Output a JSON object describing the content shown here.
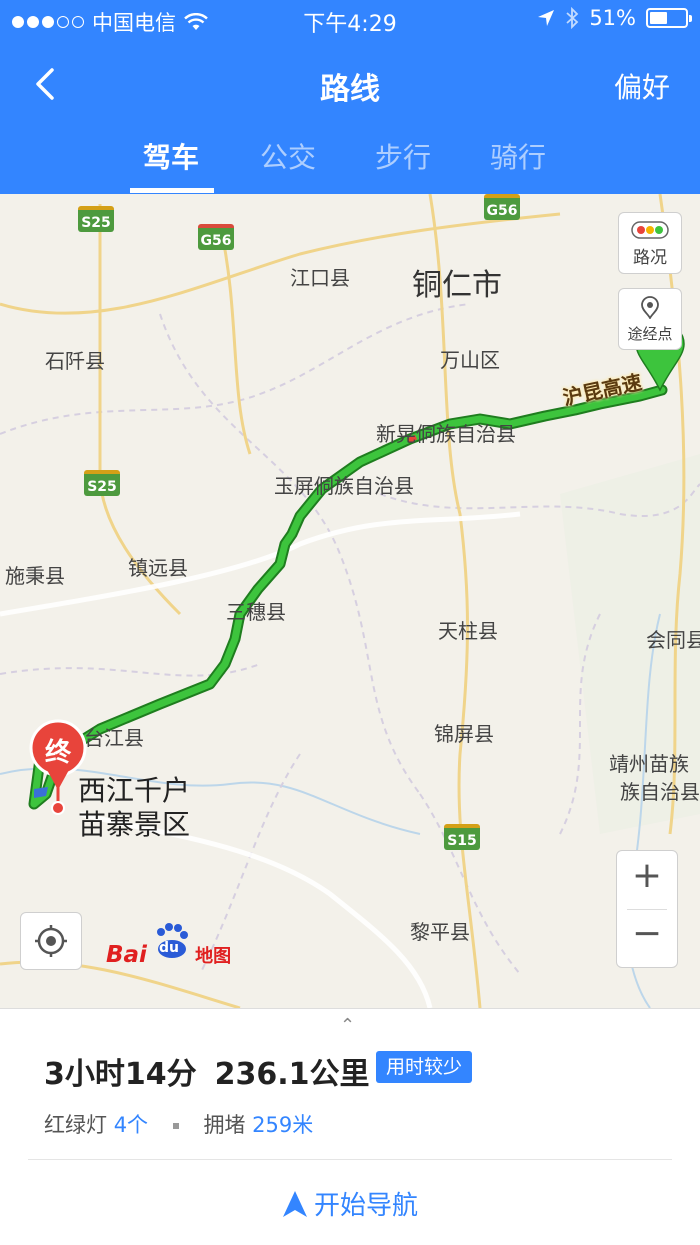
{
  "status_bar": {
    "carrier": "中国电信",
    "time": "下午4:29",
    "battery": "51%",
    "battery_level": 0.51
  },
  "nav": {
    "title": "路线",
    "right_action": "偏好"
  },
  "tabs": [
    {
      "label": "驾车",
      "active": true
    },
    {
      "label": "公交",
      "active": false
    },
    {
      "label": "步行",
      "active": false
    },
    {
      "label": "骑行",
      "active": false
    }
  ],
  "map": {
    "controls": {
      "traffic": "路况",
      "waypoint": "途经点"
    },
    "place_labels": {
      "tongren": "铜仁市",
      "jiangkou": "江口县",
      "shiqian": "石阡县",
      "wanshan": "万山区",
      "xinhuang": "新晃侗族自治县",
      "yuping": "玉屏侗族自治县",
      "shibing": "施秉县",
      "zhenyuan": "镇远县",
      "sansui": "三穗县",
      "tianzhu": "天柱县",
      "huitong": "会同县",
      "taijiang": "台江县",
      "jinping": "锦屏县",
      "jingzhou_1": "靖州苗族",
      "jingzhou_2": "族自治县",
      "liping": "黎平县"
    },
    "road_labels": {
      "hukun": "沪昆高速",
      "s25_a": "S25",
      "s25_b": "S25",
      "g56_a": "G56",
      "g56_b": "G56",
      "s15": "S15"
    },
    "destination_marker": "终",
    "destination_name_1": "西江千户",
    "destination_name_2": "苗寨景区",
    "logo": {
      "bai": "Bai",
      "du": "du",
      "ditu": "地图"
    },
    "zoom_in": "+",
    "zoom_out": "−"
  },
  "route": {
    "duration": "3小时14分",
    "distance": "236.1公里",
    "tag": "用时较少",
    "traffic_lights_label": "红绿灯",
    "traffic_lights_value": "4个",
    "congestion_label": "拥堵",
    "congestion_value": "259米",
    "start_button": "开始导航"
  },
  "colors": {
    "brand_blue": "#3385ff",
    "route_green": "#3dc43d",
    "destination_red": "#e8443b"
  }
}
